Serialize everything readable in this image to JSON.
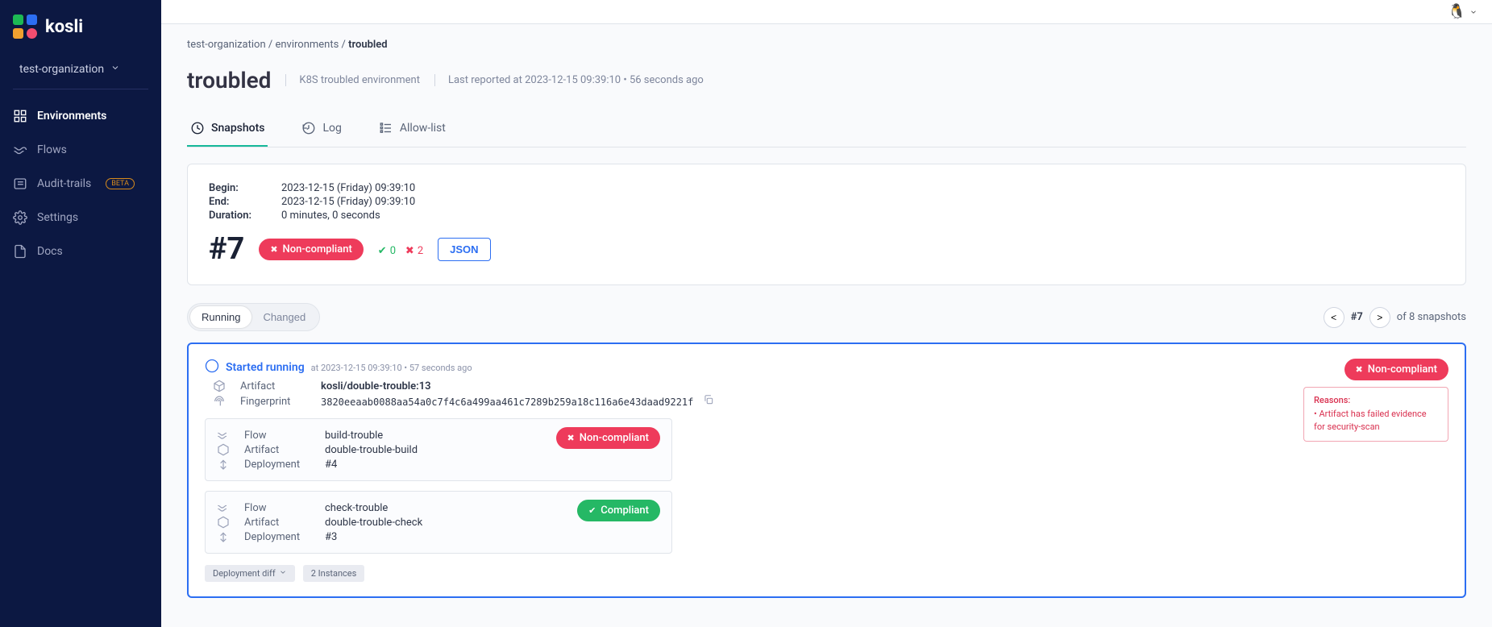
{
  "brand": "kosli",
  "org": "test-organization",
  "nav": {
    "environments": "Environments",
    "flows": "Flows",
    "audit": "Audit-trails",
    "audit_badge": "BETA",
    "settings": "Settings",
    "docs": "Docs"
  },
  "breadcrumb": {
    "org": "test-organization",
    "section": "environments",
    "current": "troubled"
  },
  "header": {
    "title": "troubled",
    "subtitle": "K8S troubled environment",
    "reported": "Last reported at 2023-12-15 09:39:10 • 56 seconds ago"
  },
  "tabs": {
    "snapshots": "Snapshots",
    "log": "Log",
    "allowlist": "Allow-list"
  },
  "summary": {
    "begin_lbl": "Begin:",
    "begin": "2023-12-15 (Friday) 09:39:10",
    "end_lbl": "End:",
    "end": "2023-12-15 (Friday) 09:39:10",
    "duration_lbl": "Duration:",
    "duration": "0 minutes, 0 seconds",
    "num": "#7",
    "compliance": "Non-compliant",
    "ok_count": "0",
    "bad_count": "2",
    "json_btn": "JSON"
  },
  "filter": {
    "running": "Running",
    "changed": "Changed"
  },
  "pager": {
    "current": "#7",
    "total_prefix": "of ",
    "total": "8 snapshots"
  },
  "artifact": {
    "status": "Started running",
    "timestamp": "at 2023-12-15 09:39:10 • 57 seconds ago",
    "artifact_lbl": "Artifact",
    "artifact_val": "kosli/double-trouble:13",
    "fingerprint_lbl": "Fingerprint",
    "fingerprint_val": "3820eeaab0088aa54a0c7f4c6a499aa461c7289b259a18c116a6e43daad9221f",
    "badge": "Non-compliant"
  },
  "reasons": {
    "title": "Reasons:",
    "item1": "• Artifact has failed evidence for security-scan"
  },
  "flow1": {
    "flow_lbl": "Flow",
    "flow_val": "build-trouble",
    "artifact_lbl": "Artifact",
    "artifact_val": "double-trouble-build",
    "deploy_lbl": "Deployment",
    "deploy_val": "#4",
    "badge": "Non-compliant"
  },
  "flow2": {
    "flow_lbl": "Flow",
    "flow_val": "check-trouble",
    "artifact_lbl": "Artifact",
    "artifact_val": "double-trouble-check",
    "deploy_lbl": "Deployment",
    "deploy_val": "#3",
    "badge": "Compliant"
  },
  "footer": {
    "diff": "Deployment diff",
    "instances": "2 Instances"
  }
}
